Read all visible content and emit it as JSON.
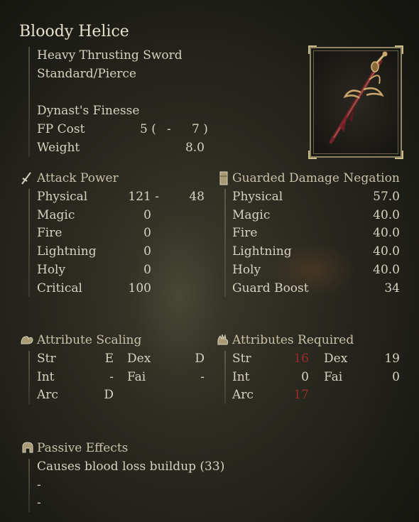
{
  "item": {
    "name": "Bloody Helice",
    "weapon_type": "Heavy Thrusting Sword",
    "damage_type": "Standard/Pierce",
    "skill": "Dynast's Finesse",
    "fp_cost_label": "FP Cost",
    "fp_cost_open": "5 (",
    "fp_cost_dash": "-",
    "fp_cost_close": "7 )",
    "weight_label": "Weight",
    "weight_value": "8.0"
  },
  "attack_power": {
    "header": "Attack Power",
    "rows": [
      {
        "label": "Physical",
        "value": "121 -",
        "extra": "48"
      },
      {
        "label": "Magic",
        "value": "0",
        "extra": ""
      },
      {
        "label": "Fire",
        "value": "0",
        "extra": ""
      },
      {
        "label": "Lightning",
        "value": "0",
        "extra": ""
      },
      {
        "label": "Holy",
        "value": "0",
        "extra": ""
      },
      {
        "label": "Critical",
        "value": "100",
        "extra": ""
      }
    ]
  },
  "guarded": {
    "header": "Guarded Damage Negation",
    "rows": [
      {
        "label": "Physical",
        "value": "57.0"
      },
      {
        "label": "Magic",
        "value": "40.0"
      },
      {
        "label": "Fire",
        "value": "40.0"
      },
      {
        "label": "Lightning",
        "value": "40.0"
      },
      {
        "label": "Holy",
        "value": "40.0"
      },
      {
        "label": "Guard Boost",
        "value": "34"
      }
    ]
  },
  "scaling": {
    "header": "Attribute Scaling",
    "str_label": "Str",
    "str_value": "E",
    "dex_label": "Dex",
    "dex_value": "D",
    "int_label": "Int",
    "int_value": "-",
    "fai_label": "Fai",
    "fai_value": "-",
    "arc_label": "Arc",
    "arc_value": "D"
  },
  "required": {
    "header": "Attributes Required",
    "str_label": "Str",
    "str_value": "16",
    "dex_label": "Dex",
    "dex_value": "19",
    "int_label": "Int",
    "int_value": "0",
    "fai_label": "Fai",
    "fai_value": "0",
    "arc_label": "Arc",
    "arc_value": "17"
  },
  "passive": {
    "header": "Passive Effects",
    "effect_1": "Causes blood loss buildup (33)",
    "effect_2": "-",
    "effect_3": "-"
  },
  "icons": {
    "attack": "sword-icon",
    "guard": "shield-icon",
    "scaling": "arm-flex-icon",
    "required": "hand-icon",
    "passive": "helmet-icon",
    "weapon": "bloody-helice-weapon-icon"
  },
  "colors": {
    "text": "#d8d2c0",
    "unmet_requirement": "#9b2b2b",
    "frame": "#8f8565"
  }
}
